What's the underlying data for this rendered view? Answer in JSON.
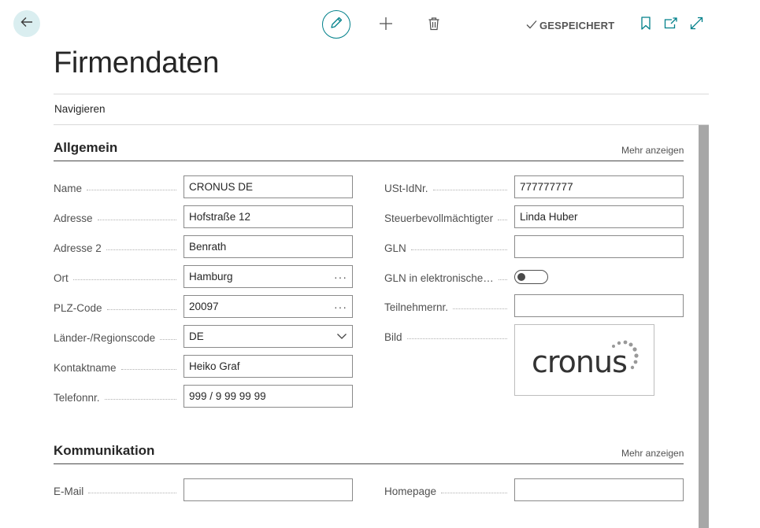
{
  "toolbar": {
    "back_icon": "arrow-left-icon",
    "edit_icon": "pencil-icon",
    "new_icon": "plus-icon",
    "delete_icon": "trash-icon",
    "saved_icon": "check-icon",
    "saved_label": "GESPEICHERT",
    "bookmark_icon": "bookmark-icon",
    "open_new_window_icon": "open-in-new-window-icon",
    "expand_icon": "expand-icon",
    "accent_color": "#00808a"
  },
  "page": {
    "title": "Firmendaten",
    "nav_label": "Navigieren"
  },
  "general": {
    "title": "Allgemein",
    "more_label": "Mehr anzeigen",
    "left_fields": [
      {
        "label": "Name",
        "value": "CRONUS DE"
      },
      {
        "label": "Adresse",
        "value": "Hofstraße 12"
      },
      {
        "label": "Adresse 2",
        "value": "Benrath"
      },
      {
        "label": "Ort",
        "value": "Hamburg",
        "lookup": "···"
      },
      {
        "label": "PLZ-Code",
        "value": "20097",
        "lookup": "···"
      },
      {
        "label": "Länder-/Regionscode",
        "value": "DE"
      },
      {
        "label": "Kontaktname",
        "value": "Heiko Graf"
      },
      {
        "label": "Telefonnr.",
        "value": "999 / 9 99 99 99"
      }
    ],
    "right_fields": [
      {
        "label": "USt-IdNr.",
        "value": "777777777"
      },
      {
        "label": "Steuerbevollmächtigter",
        "value": "Linda Huber"
      },
      {
        "label": "GLN",
        "value": ""
      },
      {
        "label": "GLN in elektronische…",
        "toggle_on": false
      },
      {
        "label": "Teilnehmernr.",
        "value": ""
      },
      {
        "label": "Bild",
        "logo_text": "cronus"
      }
    ]
  },
  "communication": {
    "title": "Kommunikation",
    "more_label": "Mehr anzeigen",
    "left_fields": [
      {
        "label": "E-Mail",
        "value": ""
      }
    ],
    "right_fields": [
      {
        "label": "Homepage",
        "value": ""
      }
    ]
  }
}
